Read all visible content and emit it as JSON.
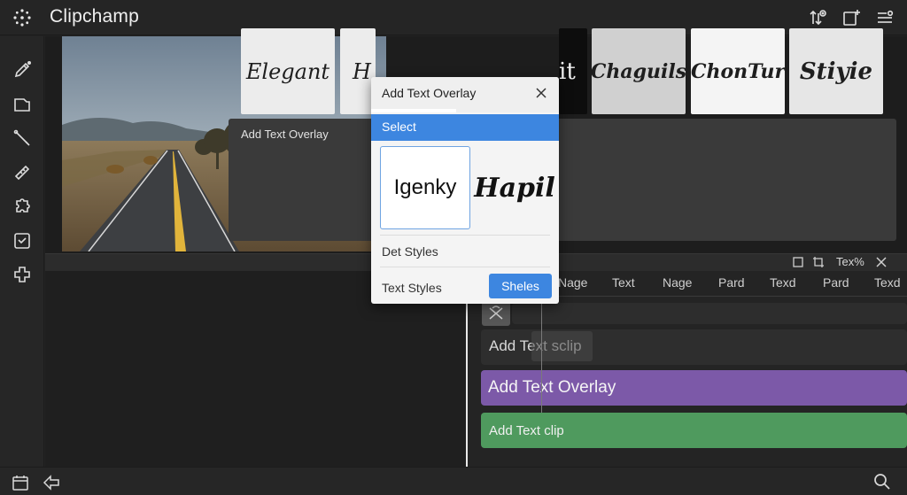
{
  "app": {
    "title": "Clipchamp"
  },
  "colors": {
    "accent": "#3d86e0",
    "overlay_track": "#7c59a8",
    "clip_track": "#4f9a5e"
  },
  "style_panel": {
    "title": "Add Text Overlay",
    "cards": [
      "Elegant",
      "H",
      "it",
      "Chaguils",
      "ChonTur",
      "Stiyie"
    ]
  },
  "dialog": {
    "title": "Add Text Overlay",
    "selected": "Select",
    "fonts": [
      "Igenky",
      "Hapil"
    ],
    "det_styles": "Det Styles",
    "text_styles": "Text Styles",
    "shelves_button": "Sheles"
  },
  "timeline": {
    "tab_label": "Tex%",
    "ruler": [
      "Nage",
      "Text",
      "Nage",
      "Pard",
      "Texd",
      "Pard",
      "Texd"
    ],
    "tracks": {
      "text_clip_top": "Add Text sclip",
      "overlay": "Add Text Overlay",
      "clip": "Add Text clip"
    }
  },
  "icons": {
    "top": [
      "adjust-icon",
      "new-icon",
      "menu-icon"
    ],
    "rail": [
      "pencil-icon",
      "folder-icon",
      "brush-icon",
      "ruler-icon",
      "puzzle-icon",
      "checkbox-icon",
      "plus-icon"
    ],
    "bottom": [
      "calendar-icon",
      "back-icon",
      "search-icon"
    ]
  }
}
